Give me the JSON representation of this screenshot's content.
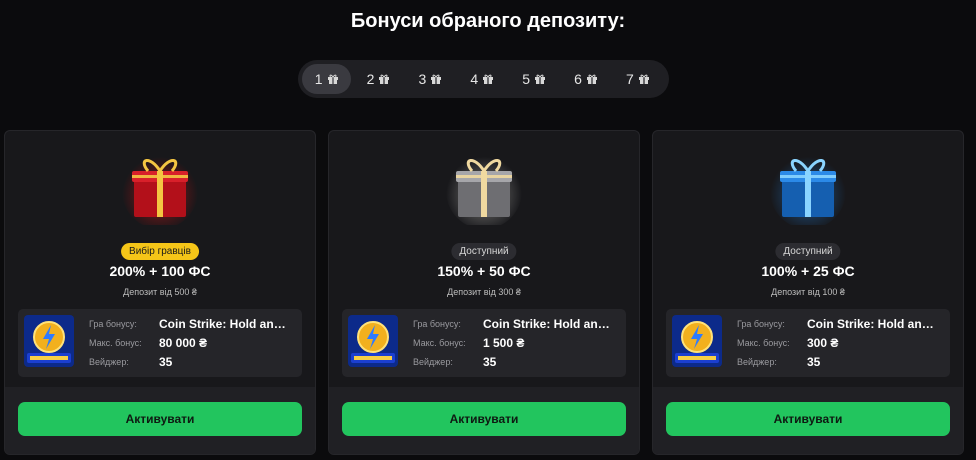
{
  "page_title": "Бонуси обраного депозиту:",
  "tabs": [
    {
      "label": "1",
      "icon": "gift-icon",
      "active": true
    },
    {
      "label": "2",
      "icon": "gift-icon"
    },
    {
      "label": "3",
      "icon": "gift-icon"
    },
    {
      "label": "4",
      "icon": "gift-icon"
    },
    {
      "label": "5",
      "icon": "gift-icon"
    },
    {
      "label": "6",
      "icon": "gift-icon"
    },
    {
      "label": "7",
      "icon": "gift-icon"
    }
  ],
  "cards": [
    {
      "gift_color": "#c8141c",
      "ribbon_color": "#f4c542",
      "badge": "Вибір гравців",
      "badge_color": "#f5c518",
      "title": "200% + 100 ФС",
      "min_deposit": "Депозит від 500 ₴",
      "game_label": "Гра бонусу:",
      "game_value": "Coin Strike: Hold and …",
      "max_label": "Макс. бонус:",
      "max_value": "80 000 ₴",
      "wager_label": "Вейджер:",
      "wager_value": "35",
      "button": "Активувати"
    },
    {
      "gift_color": "#8a8a8e",
      "ribbon_color": "#f0d9a0",
      "badge": "Доступний",
      "badge_color": "#2c2c31",
      "title": "150% + 50 ФС",
      "min_deposit": "Депозит від 300 ₴",
      "game_label": "Гра бонусу:",
      "game_value": "Coin Strike: Hold and …",
      "max_label": "Макс. бонус:",
      "max_value": "1 500 ₴",
      "wager_label": "Вейджер:",
      "wager_value": "35",
      "button": "Активувати"
    },
    {
      "gift_color": "#1c7fe0",
      "ribbon_color": "#8ad4ff",
      "badge": "Доступний",
      "badge_color": "#2c2c31",
      "title": "100% + 25 ФС",
      "min_deposit": "Депозит від 100 ₴",
      "game_label": "Гра бонусу:",
      "game_value": "Coin Strike: Hold and …",
      "max_label": "Макс. бонус:",
      "max_value": "300 ₴",
      "wager_label": "Вейджер:",
      "wager_value": "35",
      "button": "Активувати"
    }
  ],
  "accent_color": "#22c55e"
}
